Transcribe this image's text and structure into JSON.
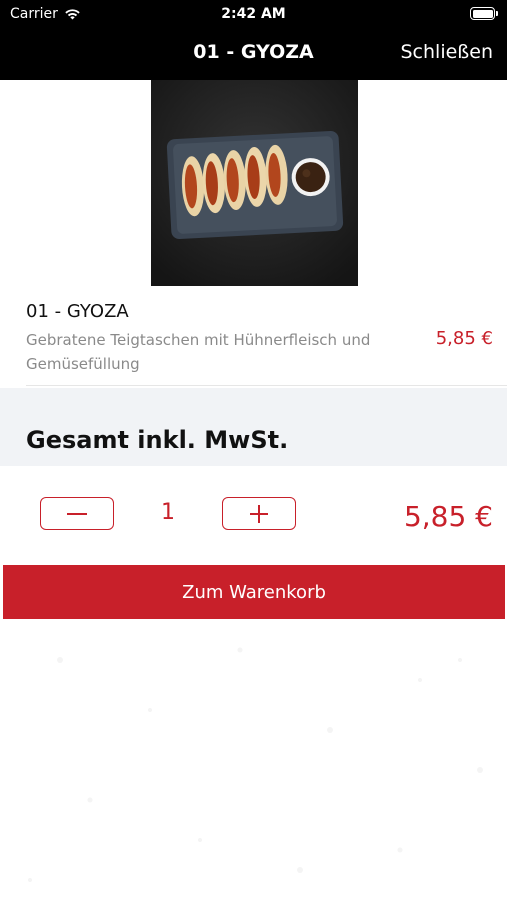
{
  "status_bar": {
    "carrier": "Carrier",
    "time": "2:42 AM",
    "icons": [
      "wifi-icon",
      "battery-icon"
    ]
  },
  "nav": {
    "title": "01 - GYOZA",
    "close_label": "Schließen"
  },
  "product": {
    "image_icon": "gyoza-plate-image",
    "title": "01 - GYOZA",
    "description": "Gebratene Teigtaschen mit Hühnerfleisch und Gemüsefüllung",
    "price": "5,85 €"
  },
  "total": {
    "label": "Gesamt inkl. MwSt.",
    "quantity": "1",
    "price": "5,85 €",
    "decrement_icon": "minus-icon",
    "increment_icon": "plus-icon"
  },
  "cart_button": {
    "label": "Zum Warenkorb"
  },
  "colors": {
    "accent": "#c8202a",
    "nav_background": "#000000",
    "section_background": "#f1f3f6",
    "description_text": "#8a8a8a"
  }
}
